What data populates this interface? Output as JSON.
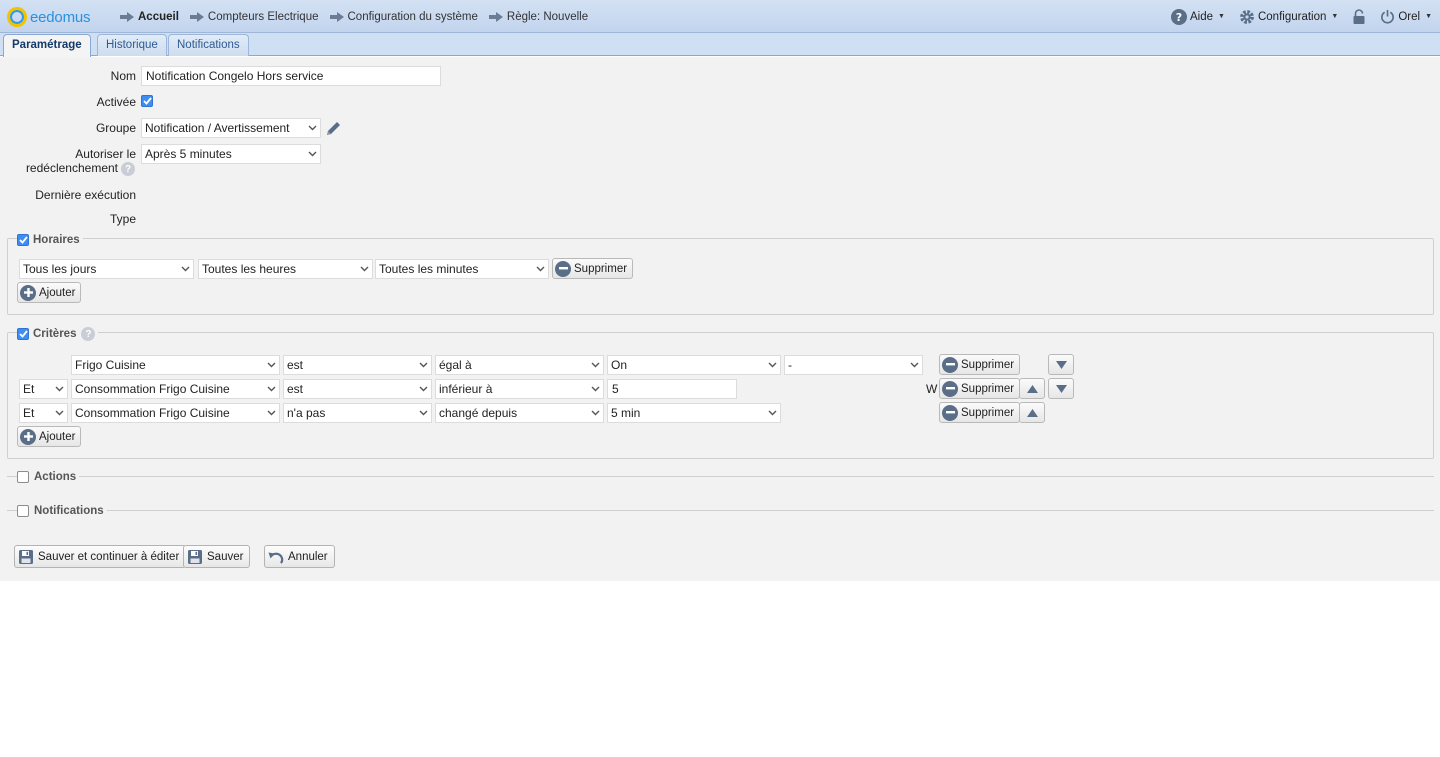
{
  "header": {
    "logo_text": "eedomus",
    "breadcrumbs": [
      "Accueil",
      "Compteurs Electrique",
      "Configuration du système",
      "Règle: Nouvelle"
    ],
    "help_label": "Aide",
    "config_label": "Configuration",
    "user_label": "Orel"
  },
  "tabs": [
    "Paramétrage",
    "Historique",
    "Notifications"
  ],
  "form": {
    "nom_label": "Nom",
    "nom_value": "Notification Congelo Hors service",
    "activee_label": "Activée",
    "groupe_label": "Groupe",
    "groupe_value": "Notification / Avertissement",
    "autoriser_label_1": "Autoriser le",
    "autoriser_label_2": "redéclenchement",
    "autoriser_value": "Après 5 minutes",
    "derniere_label": "Dernière exécution",
    "type_label": "Type"
  },
  "horaires": {
    "legend": "Horaires",
    "jours": "Tous les jours",
    "heures": "Toutes les heures",
    "minutes": "Toutes les minutes",
    "supprimer": "Supprimer",
    "ajouter": "Ajouter"
  },
  "criteres": {
    "legend": "Critères",
    "rows": [
      {
        "conj": "",
        "device": "Frigo Cuisine",
        "verb": "est",
        "op": "égal à",
        "value": "On",
        "extra": "-",
        "unit": "",
        "supprimer": "Supprimer"
      },
      {
        "conj": "Et",
        "device": "Consommation Frigo Cuisine",
        "verb": "est",
        "op": "inférieur à",
        "value": "5",
        "extra": "",
        "unit": "W",
        "supprimer": "Supprimer"
      },
      {
        "conj": "Et",
        "device": "Consommation Frigo Cuisine",
        "verb": "n'a pas",
        "op": "changé depuis",
        "value": "5 min",
        "extra": "",
        "unit": "",
        "supprimer": "Supprimer"
      }
    ],
    "ajouter": "Ajouter"
  },
  "sections": {
    "actions": "Actions",
    "notifications": "Notifications"
  },
  "footer": {
    "save_continue": "Sauver et continuer à éditer",
    "save": "Sauver",
    "cancel": "Annuler"
  },
  "colors": {
    "topbar": "#c7d8ef",
    "accent": "#3e8df3",
    "logo_blue": "#2a91dd",
    "logo_yellow": "#f3c300"
  }
}
